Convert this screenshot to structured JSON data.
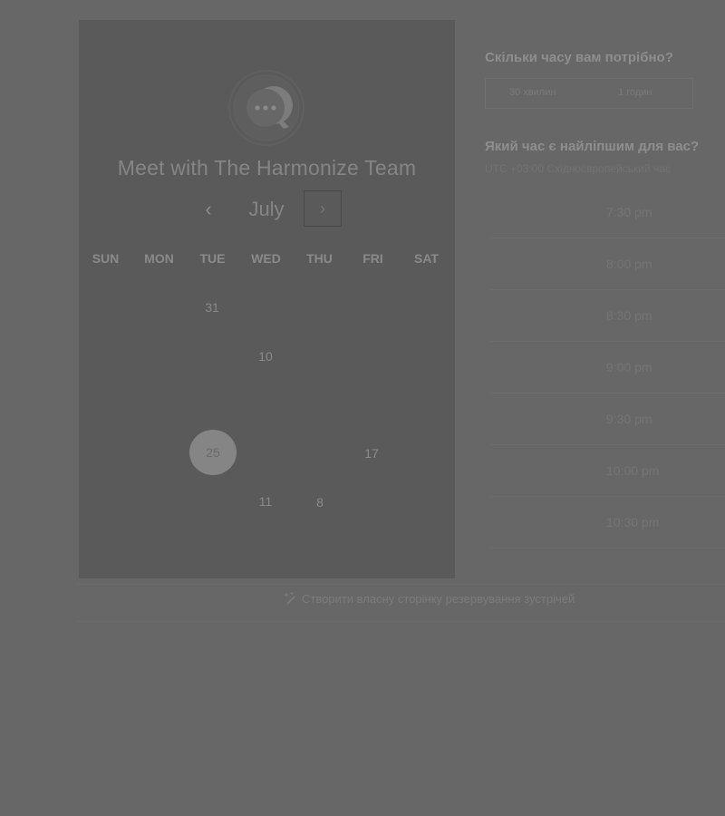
{
  "calendar": {
    "title": "Meet with The Harmonize Team",
    "month": "July",
    "prev_glyph": "‹",
    "next_glyph": "›",
    "weekdays": [
      "SUN",
      "MON",
      "TUE",
      "WED",
      "THU",
      "FRI",
      "SAT"
    ],
    "days": [
      "31",
      "10",
      "17",
      "11",
      "8"
    ],
    "selected_day": "25"
  },
  "duration": {
    "title": "Скільки часу вам потрібно?",
    "options": [
      "30 хвилин",
      "1 годин"
    ]
  },
  "timeslots": {
    "title": "Який час є найліпшим для вас?",
    "timezone": "UTC +03:00 Східноєвропейський час",
    "slots": [
      "7:30 pm",
      "8:00 pm",
      "8:30 pm",
      "9:00 pm",
      "9:30 pm",
      "10:00 pm",
      "10:30 pm"
    ]
  },
  "footer": {
    "link_text": "Створити власну сторінку резервування зустрічей",
    "icon": "wand-icon"
  },
  "colors": {
    "background": "#676767",
    "panel": "#5a5a5a",
    "selected_day": "#858585"
  }
}
